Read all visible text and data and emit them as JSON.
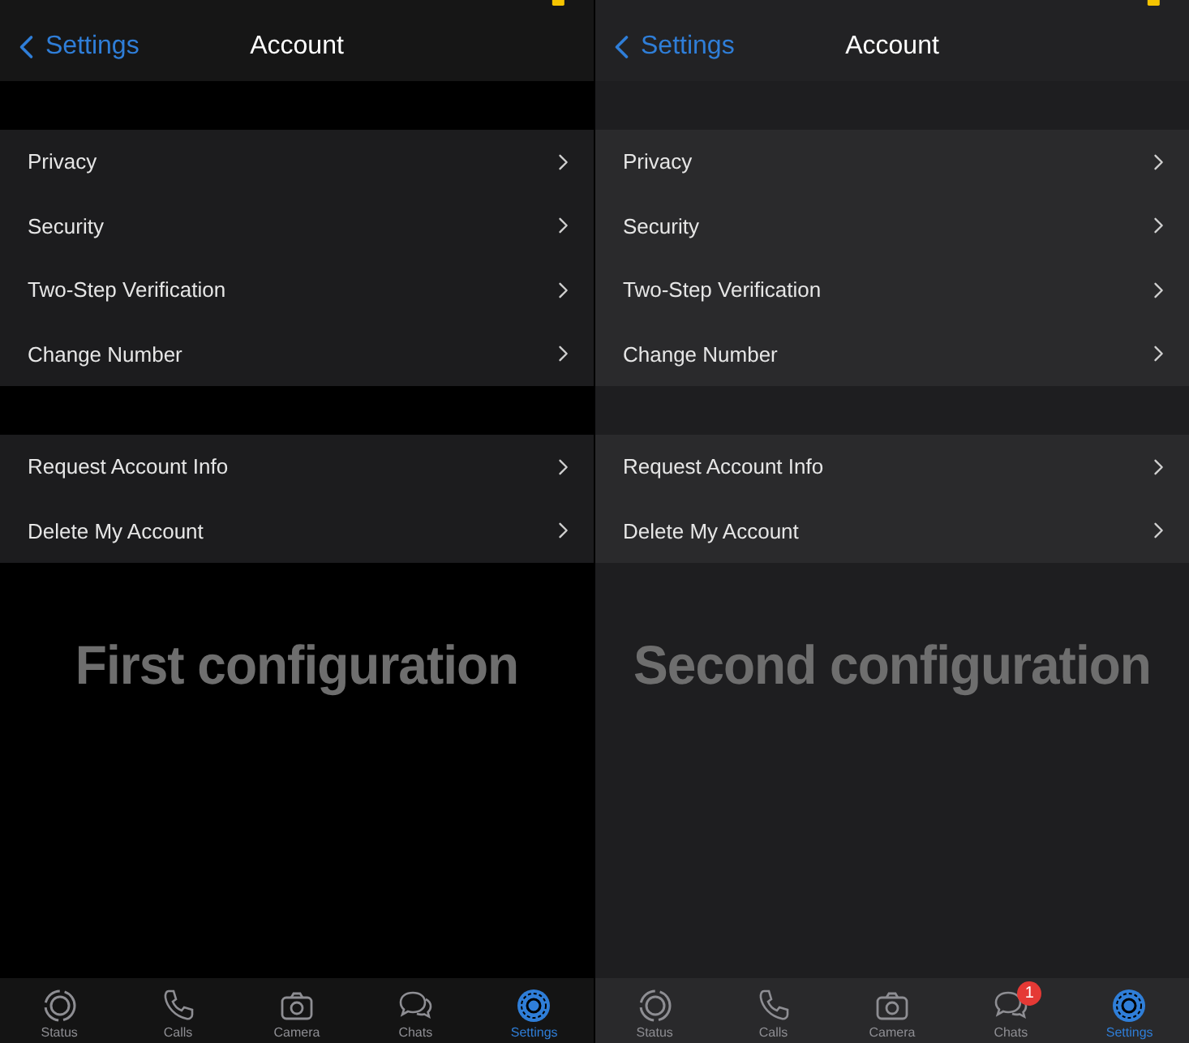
{
  "panels": [
    {
      "kind": "black",
      "nav": {
        "back": "Settings",
        "title": "Account"
      },
      "sections": [
        {
          "items": [
            "Privacy",
            "Security",
            "Two-Step Verification",
            "Change Number"
          ]
        },
        {
          "items": [
            "Request Account Info",
            "Delete My Account"
          ]
        }
      ],
      "caption": "First configuration",
      "tabs": [
        {
          "label": "Status",
          "kind": "status",
          "selected": false
        },
        {
          "label": "Calls",
          "kind": "calls",
          "selected": false
        },
        {
          "label": "Camera",
          "kind": "camera",
          "selected": false
        },
        {
          "label": "Chats",
          "kind": "chats",
          "selected": false
        },
        {
          "label": "Settings",
          "kind": "settings",
          "selected": true
        }
      ]
    },
    {
      "kind": "grey",
      "nav": {
        "back": "Settings",
        "title": "Account"
      },
      "sections": [
        {
          "items": [
            "Privacy",
            "Security",
            "Two-Step Verification",
            "Change Number"
          ]
        },
        {
          "items": [
            "Request Account Info",
            "Delete My Account"
          ]
        }
      ],
      "caption": "Second configuration",
      "tabs": [
        {
          "label": "Status",
          "kind": "status",
          "selected": false
        },
        {
          "label": "Calls",
          "kind": "calls",
          "selected": false
        },
        {
          "label": "Camera",
          "kind": "camera",
          "selected": false
        },
        {
          "label": "Chats",
          "kind": "chats",
          "selected": false,
          "badge": "1"
        },
        {
          "label": "Settings",
          "kind": "settings",
          "selected": true
        }
      ]
    }
  ]
}
